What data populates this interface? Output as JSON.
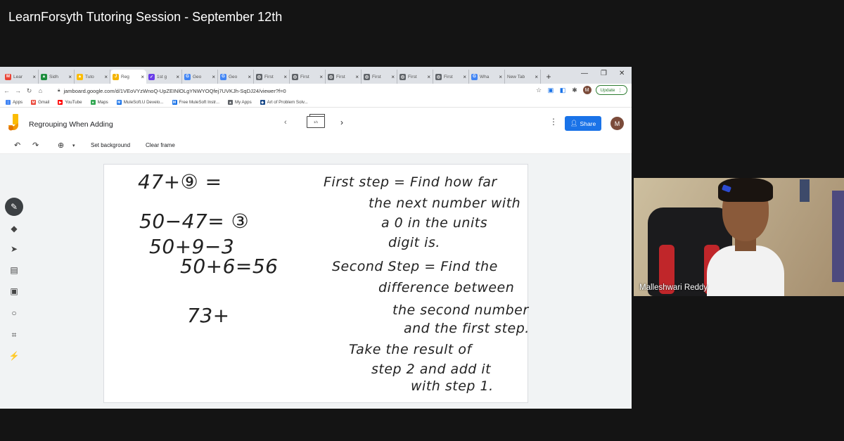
{
  "video": {
    "title": "LearnForsyth Tutoring Session - September 12th"
  },
  "browser": {
    "tabs": [
      {
        "label": "Lear",
        "fav_color": "#ea4335",
        "fav_char": "M"
      },
      {
        "label": "Sidh",
        "fav_color": "#1e8e3e",
        "fav_char": "▲"
      },
      {
        "label": "Tuto",
        "fav_color": "#fbbc04",
        "fav_char": "▲"
      },
      {
        "label": "Reg",
        "fav_color": "#f4b400",
        "fav_char": "J"
      },
      {
        "label": "1st g",
        "fav_color": "#6a3de8",
        "fav_char": "✓"
      },
      {
        "label": "Geo",
        "fav_color": "#4285f4",
        "fav_char": "G"
      },
      {
        "label": "Geo",
        "fav_color": "#4285f4",
        "fav_char": "G"
      },
      {
        "label": "First",
        "fav_color": "#5f6368",
        "fav_char": "◎"
      },
      {
        "label": "First",
        "fav_color": "#5f6368",
        "fav_char": "◎"
      },
      {
        "label": "First",
        "fav_color": "#5f6368",
        "fav_char": "◎"
      },
      {
        "label": "First",
        "fav_color": "#5f6368",
        "fav_char": "◎"
      },
      {
        "label": "First",
        "fav_color": "#5f6368",
        "fav_char": "◎"
      },
      {
        "label": "First",
        "fav_color": "#5f6368",
        "fav_char": "◎"
      },
      {
        "label": "Wha",
        "fav_color": "#4285f4",
        "fav_char": "G"
      },
      {
        "label": "New Tab",
        "fav_color": "",
        "fav_char": ""
      }
    ],
    "new_tab_icon": "+",
    "url": "jamboard.google.com/d/1VEoVYzWnoQ-UpZEINlOLgYNWYOQfej7UVKJh-SqDJ24/viewer?f=0",
    "update_label": "Update",
    "profile_initial": "M",
    "bookmarks": [
      {
        "label": "Apps",
        "color": "#4285f4",
        "char": "⋮"
      },
      {
        "label": "Gmail",
        "color": "#ea4335",
        "char": "M"
      },
      {
        "label": "YouTube",
        "color": "#ff0000",
        "char": "▶"
      },
      {
        "label": "Maps",
        "color": "#34a853",
        "char": "●"
      },
      {
        "label": "MuleSoft.U Develo...",
        "color": "#1a73e8",
        "char": "M"
      },
      {
        "label": "Free MuleSoft Instr...",
        "color": "#1a73e8",
        "char": "M"
      },
      {
        "label": "My Apps",
        "color": "#5f6368",
        "char": "▲"
      },
      {
        "label": "Art of Problem Solv...",
        "color": "#1a4a8a",
        "char": "◆"
      }
    ]
  },
  "jamboard": {
    "title": "Regrouping When Adding",
    "frame_indicator": "1/1",
    "share_label": "Share",
    "profile_initial": "M",
    "toolbar": {
      "set_background": "Set background",
      "clear_frame": "Clear frame"
    },
    "board": {
      "equations": [
        "47+⑨ =",
        "50−47= ③",
        "50+9−3",
        "50+6=56",
        "73+"
      ],
      "notes": [
        "First step = Find how far",
        "the next number with",
        "a 0 in the units",
        "digit is.",
        "Second Step = Find the",
        "difference between",
        "the second number",
        "and the first step.",
        "Take the result of",
        "step 2 and add it",
        "with step 1."
      ]
    }
  },
  "webcam": {
    "participant_name": "Malleshwari Reddy"
  }
}
